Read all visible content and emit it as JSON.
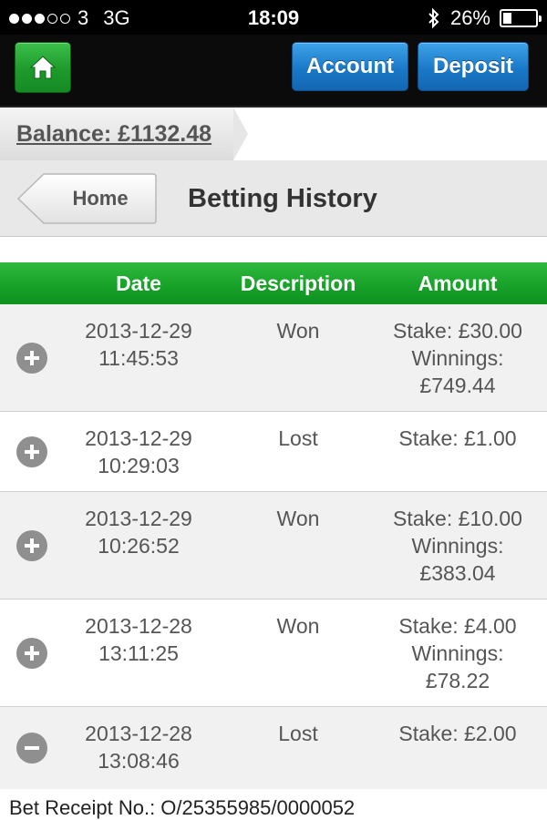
{
  "status_bar": {
    "carrier": "3",
    "network": "3G",
    "time": "18:09",
    "battery_percent": "26%",
    "battery_level": 0.26,
    "signal_bars_on": 3,
    "signal_bars_total": 5
  },
  "nav": {
    "account_label": "Account",
    "deposit_label": "Deposit"
  },
  "balance": {
    "text": "Balance: £1132.48"
  },
  "title_bar": {
    "back_label": "Home",
    "page_title": "Betting History"
  },
  "table": {
    "headers": {
      "date": "Date",
      "description": "Description",
      "amount": "Amount"
    },
    "rows": [
      {
        "date": "2013-12-29",
        "time": "11:45:53",
        "description": "Won",
        "stake": "Stake: £30.00",
        "winnings_label": "Winnings:",
        "winnings": "£749.44",
        "expanded": false
      },
      {
        "date": "2013-12-29",
        "time": "10:29:03",
        "description": "Lost",
        "stake": "Stake: £1.00",
        "expanded": false
      },
      {
        "date": "2013-12-29",
        "time": "10:26:52",
        "description": "Won",
        "stake": "Stake: £10.00",
        "winnings_label": "Winnings:",
        "winnings": "£383.04",
        "expanded": false
      },
      {
        "date": "2013-12-28",
        "time": "13:11:25",
        "description": "Won",
        "stake": "Stake: £4.00",
        "winnings_label": "Winnings:",
        "winnings": "£78.22",
        "expanded": false
      },
      {
        "date": "2013-12-28",
        "time": "13:08:46",
        "description": "Lost",
        "stake": "Stake: £2.00",
        "expanded": true
      }
    ]
  },
  "receipt": {
    "text": "Bet Receipt No.: O/25355985/0000052"
  },
  "colors": {
    "nav_green": "#1d9a2b",
    "nav_blue": "#1a79c9",
    "header_green": "#16a027",
    "row_alt": "#f1f1f1"
  }
}
